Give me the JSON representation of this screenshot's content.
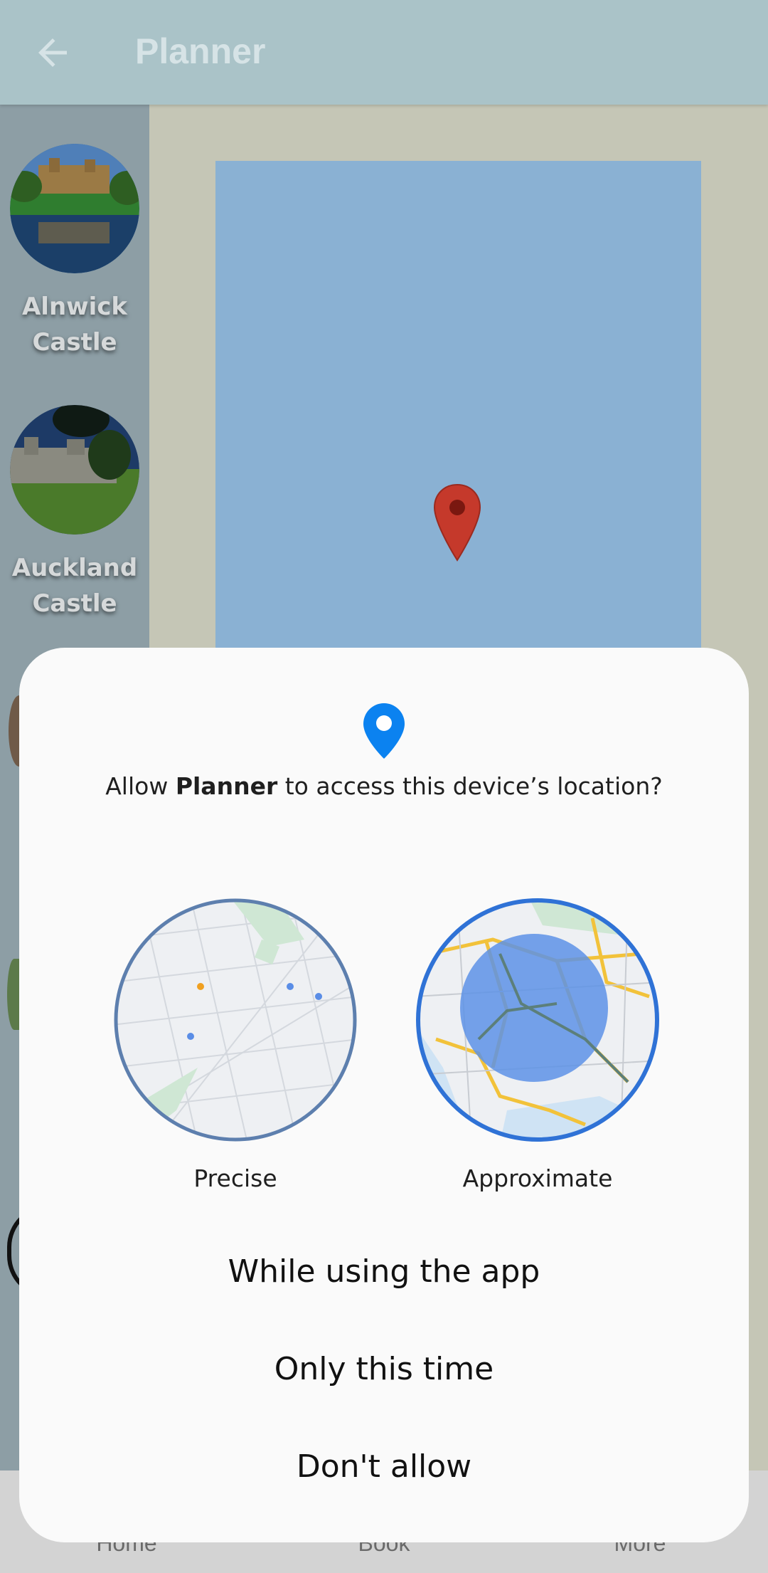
{
  "app": {
    "title": "Planner",
    "castles": [
      {
        "name_line1": "Alnwick",
        "name_line2": "Castle"
      },
      {
        "name_line1": "Auckland",
        "name_line2": "Castle"
      }
    ],
    "nav": {
      "home": "Home",
      "book": "Book",
      "more": "More"
    }
  },
  "dialog": {
    "prefix": "Allow ",
    "app_name": "Planner",
    "suffix": " to access this device’s location?",
    "precise_label": "Precise",
    "approximate_label": "Approximate",
    "buttons": {
      "while_using": "While using the app",
      "only_this_time": "Only this time",
      "dont_allow": "Don't allow"
    }
  },
  "colors": {
    "accent_blue": "#1a73e8",
    "pin_red": "#c5392b",
    "map_water": "#8ab1d3"
  },
  "icons": [
    "back-arrow-icon",
    "map-pin-icon",
    "location-pin-icon"
  ]
}
